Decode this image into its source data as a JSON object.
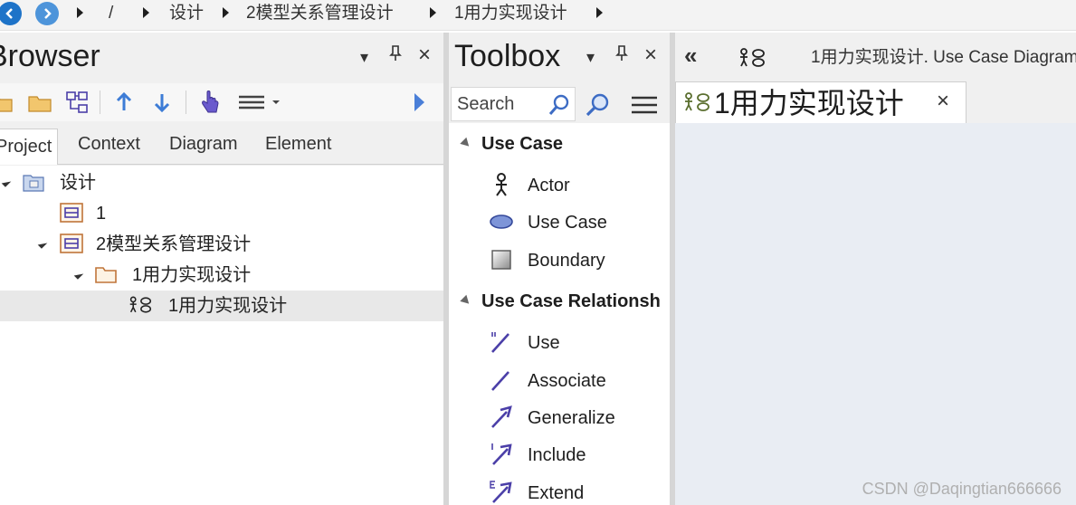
{
  "breadcrumb": {
    "root": "/",
    "items": [
      "设计",
      "2模型关系管理设计",
      "1用力实现设计"
    ]
  },
  "browser": {
    "title": "Browser",
    "tabs": [
      "Project",
      "Context",
      "Diagram",
      "Element"
    ],
    "tree": [
      {
        "label": "设计",
        "icon": "package-root-icon",
        "expanded": true,
        "level": 0
      },
      {
        "label": "1",
        "icon": "model-package-icon",
        "level": 1
      },
      {
        "label": "2模型关系管理设计",
        "icon": "model-package-icon",
        "expanded": true,
        "level": 1
      },
      {
        "label": "1用力实现设计",
        "icon": "folder-icon",
        "expanded": true,
        "level": 2
      },
      {
        "label": "1用力实现设计",
        "icon": "use-case-diagram-icon",
        "selected": true,
        "level": 3
      }
    ]
  },
  "toolbox": {
    "title": "Toolbox",
    "search_placeholder": "Search",
    "groups": [
      {
        "label": "Use Case",
        "items": [
          "Actor",
          "Use Case",
          "Boundary"
        ]
      },
      {
        "label": "Use Case Relationsh",
        "items": [
          "Use",
          "Associate",
          "Generalize",
          "Include",
          "Extend"
        ]
      }
    ]
  },
  "diagram": {
    "header_title": "1用力实现设计.  Use Case Diagram",
    "tab_title": "1用力实现设计",
    "close_glyph": "×",
    "collapse_glyph": "«"
  },
  "panel_buttons": {
    "dropdown": "▾",
    "pin": "📌",
    "close": "×"
  },
  "watermark": "CSDN @Daqingtian666666",
  "colors": {
    "accent": "#1e73c8",
    "icon_purple": "#4b3fa8",
    "canvas": "#e9edf3"
  }
}
